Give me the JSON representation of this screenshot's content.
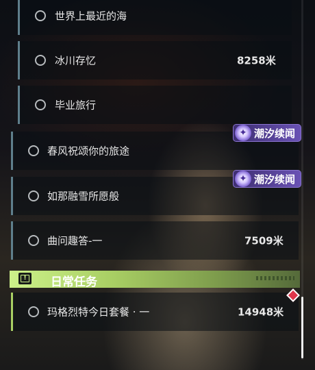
{
  "quests": [
    {
      "title": "世界上最近的海",
      "distance": ""
    },
    {
      "title": "冰川存忆",
      "distance": "8258米"
    },
    {
      "title": "毕业旅行",
      "distance": ""
    },
    {
      "title": "春风祝颂你的旅途",
      "distance": "",
      "tag": "潮汐续闻"
    },
    {
      "title": "如那融雪所愿般",
      "distance": "",
      "tag": "潮汐续闻"
    },
    {
      "title": "曲问趣答-一",
      "distance": "7509米"
    }
  ],
  "daily_section": {
    "title": "日常任务",
    "icon": "exclamation-box-icon",
    "quests": [
      {
        "title": "玛格烈特今日套餐 · 一",
        "distance": "14948米"
      }
    ]
  },
  "colors": {
    "accent_green": "#cdf18a",
    "tag_purple": "#6a52b5",
    "alert_red": "#e0344a"
  }
}
